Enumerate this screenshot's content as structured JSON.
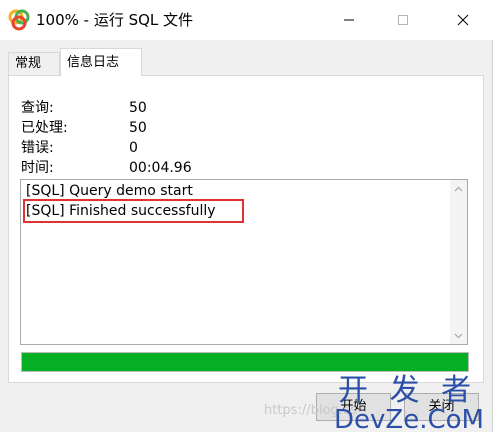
{
  "window": {
    "title": "100% - 运行 SQL 文件"
  },
  "tabs": [
    {
      "label": "常规",
      "active": false
    },
    {
      "label": "信息日志",
      "active": true
    }
  ],
  "stats": [
    {
      "label": "查询:",
      "value": "50"
    },
    {
      "label": "已处理:",
      "value": "50"
    },
    {
      "label": "错误:",
      "value": "0"
    },
    {
      "label": "时间:",
      "value": "00:04.96"
    }
  ],
  "log": {
    "lines": [
      "[SQL] Query demo start",
      "[SQL] Finished successfully"
    ],
    "highlighted_line": 1
  },
  "progress": {
    "percent": 100,
    "color": "#06b025"
  },
  "buttons": {
    "start": "开始",
    "close": "关闭"
  },
  "colors": {
    "highlight_border": "#e0322e",
    "progress_fill": "#06b025"
  },
  "icons": {
    "app": "navicat-app-icon",
    "minimize": "minimize-icon",
    "maximize": "maximize-icon",
    "close": "close-icon"
  }
}
